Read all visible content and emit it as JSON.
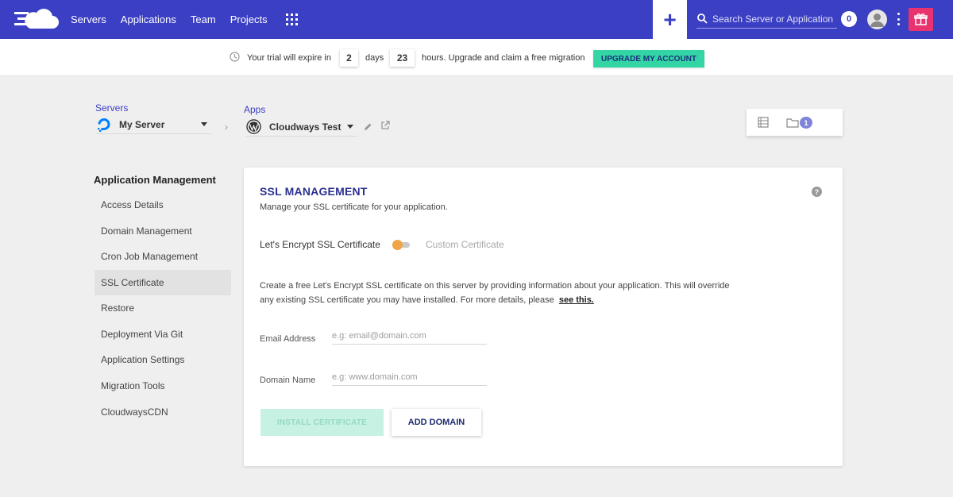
{
  "nav": {
    "links": [
      "Servers",
      "Applications",
      "Team",
      "Projects"
    ],
    "add_label": "+",
    "search_placeholder": "Search Server or Application",
    "notification_count": "0",
    "brand_color": "#3b3fc4",
    "gift_color": "#e8336e"
  },
  "trial": {
    "text_before": "Your trial will expire in",
    "days_value": "2",
    "days_label": "days",
    "hours_value": "23",
    "text_after": "hours. Upgrade and claim a free migration",
    "upgrade_label": "UPGRADE MY ACCOUNT",
    "upgrade_color": "#33d5a4"
  },
  "breadcrumb": {
    "servers_label": "Servers",
    "server_name": "My Server",
    "apps_label": "Apps",
    "app_name": "Cloudways Test"
  },
  "toolbox": {
    "folder_badge": "1"
  },
  "sidebar": {
    "title": "Application Management",
    "items": [
      "Access Details",
      "Domain Management",
      "Cron Job Management",
      "SSL Certificate",
      "Restore",
      "Deployment Via Git",
      "Application Settings",
      "Migration Tools",
      "CloudwaysCDN"
    ],
    "active_index": 3
  },
  "ssl": {
    "title": "SSL MANAGEMENT",
    "subtitle": "Manage your SSL certificate for your application.",
    "help_label": "?",
    "option_left": "Let's Encrypt SSL Certificate",
    "option_right": "Custom Certificate",
    "description": "Create a free Let's Encrypt SSL certificate on this server by providing information about your application. This will override any existing SSL certificate you may have installed. For more details, please",
    "description_link": "see this.",
    "email_label": "Email Address",
    "email_placeholder": "e.g: email@domain.com",
    "email_value": "",
    "domain_label": "Domain Name",
    "domain_placeholder": "e.g: www.domain.com",
    "domain_value": "",
    "install_label": "INSTALL CERTIFICATE",
    "add_domain_label": "ADD DOMAIN"
  }
}
